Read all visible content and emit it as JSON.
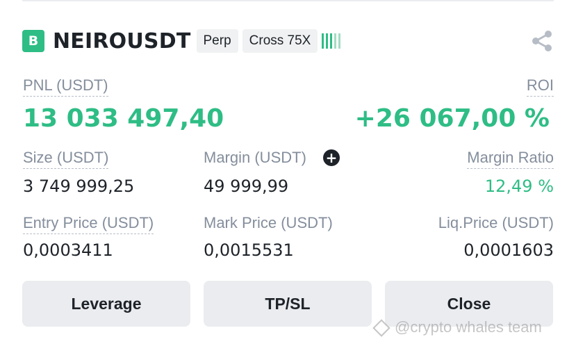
{
  "header": {
    "badge": "B",
    "symbol": "NEIROUSDT",
    "type_tag": "Perp",
    "margin_tag": "Cross 75X"
  },
  "pnl": {
    "label": "PNL (USDT)",
    "value": "13 033 497,40"
  },
  "roi": {
    "label": "ROI",
    "value": "+26 067,00 %"
  },
  "size": {
    "label": "Size (USDT)",
    "value": "3 749 999,25"
  },
  "margin": {
    "label": "Margin (USDT)",
    "value": "49 999,99"
  },
  "margin_ratio": {
    "label": "Margin Ratio",
    "value": "12,49 %"
  },
  "entry_price": {
    "label": "Entry Price (USDT)",
    "value": "0,0003411"
  },
  "mark_price": {
    "label": "Mark Price (USDT)",
    "value": "0,0015531"
  },
  "liq_price": {
    "label": "Liq.Price (USDT)",
    "value": "0,0001603"
  },
  "buttons": {
    "leverage": "Leverage",
    "tpsl": "TP/SL",
    "close": "Close"
  },
  "watermark": "@crypto whales team",
  "colors": {
    "green": "#2ebd85",
    "text": "#1e2329",
    "muted": "#848e9c",
    "button_bg": "#eaecef"
  }
}
